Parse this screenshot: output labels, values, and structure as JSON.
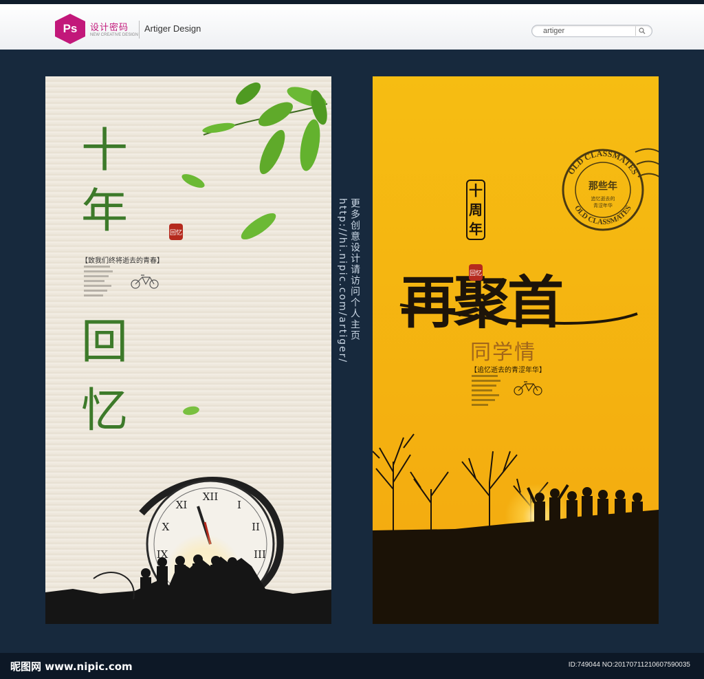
{
  "header": {
    "logo_icon_text": "Ps",
    "logo_cn": "设计密码",
    "logo_en": "NEW CREATIVE DESIGN",
    "brand": "Artiger Design",
    "search_value": "artiger"
  },
  "left_poster": {
    "chars": [
      "十",
      "年",
      "回",
      "忆"
    ],
    "seal": "回忆",
    "tagline": "【致我们终将逝去的青春】"
  },
  "vertical_link": "更多创意设计请访问个人主页 http://hi.nipic.com/artiger/",
  "right_poster": {
    "ten_years": "十周年",
    "title": "再聚首",
    "seal": "回忆",
    "subtitle": "同学情",
    "tagline": "【追忆逝去的青涩年华】",
    "stamp_top": "OLD CLASSMATES",
    "stamp_bottom": "OLD CLASSMATES",
    "stamp_center": "那些年",
    "stamp_sub1": "追忆逝去的",
    "stamp_sub2": "青涩年华"
  },
  "footer": {
    "brand": "昵图网 www.nipic.com",
    "id": "ID:749044 NO:20170711210607590035"
  },
  "colors": {
    "background": "#17293d",
    "right_poster": "#f6bd12",
    "left_poster": "#ece6da",
    "green_text": "#3d7a2a",
    "seal_red": "#b52a1e"
  }
}
